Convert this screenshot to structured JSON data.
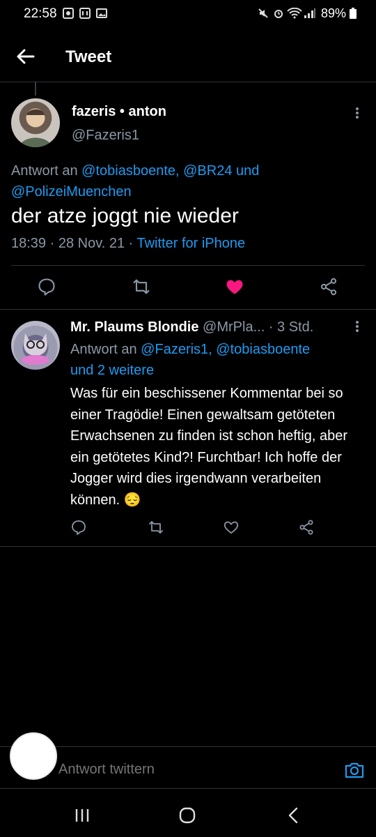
{
  "status_bar": {
    "time": "22:58",
    "battery": "89%"
  },
  "header": {
    "title": "Tweet"
  },
  "main_tweet": {
    "display_name": "fazeris • anton",
    "handle": "@Fazeris1",
    "reply_prefix": "Antwort an ",
    "reply_to_1": "@tobiasboente, @BR24",
    "reply_and": " und",
    "reply_to_2": "@PolizeiMuenchen",
    "text": "der atze joggt nie wieder",
    "timestamp": "18:39 · 28 Nov. 21 · ",
    "source": "Twitter for iPhone",
    "liked": true,
    "like_color": "#f91880"
  },
  "reply_tweet": {
    "display_name": "Mr. Plaums Blondie",
    "handle": "@MrPla...",
    "time": "· 3 Std.",
    "reply_prefix": "Antwort an ",
    "reply_to": "@Fazeris1, @tobiasboente",
    "reply_more": "und 2 weitere",
    "text": "Was für ein beschissener Kommentar bei so einer Tragödie! Einen gewaltsam getöteten Erwachsenen zu finden ist schon heftig, aber ein getötetes Kind?! Furchtbar! Ich hoffe der Jogger wird dies irgendwann verarbeiten können. 😔"
  },
  "compose": {
    "placeholder": "Antwort twittern"
  },
  "colors": {
    "accent": "#1d9bf0",
    "muted": "#8b98a5",
    "background": "#000000"
  }
}
